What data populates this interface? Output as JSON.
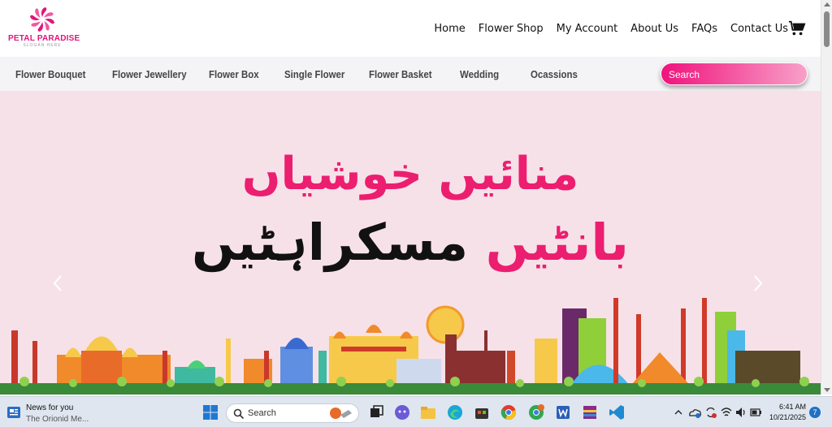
{
  "brand": {
    "name": "PETAL PARADISE",
    "slogan": "SLOGAN HERE"
  },
  "topnav": [
    "Home",
    "Flower Shop",
    "My Account",
    "About Us",
    "FAQs",
    "Contact Us"
  ],
  "categories": [
    "Flower Bouquet",
    "Flower Jewellery",
    "Flower Box",
    "Single Flower",
    "Flower Basket",
    "Wedding",
    "Ocassions"
  ],
  "search": {
    "placeholder": "Search"
  },
  "hero": {
    "line1": "منائیں خوشیاں",
    "line2_pink": "بانٹیں",
    "line2_black": "مسکراہٹیں"
  },
  "taskbar": {
    "news_title": "News for you",
    "news_subtitle": "The Orionid Me...",
    "search_label": "Search",
    "time": "6:41 AM",
    "date": "10/21/2025",
    "notification_count": "7"
  },
  "colors": {
    "accent": "#ec1e6f",
    "hero_bg": "#f7e1e8",
    "catbar_bg": "#f4f4f6"
  }
}
